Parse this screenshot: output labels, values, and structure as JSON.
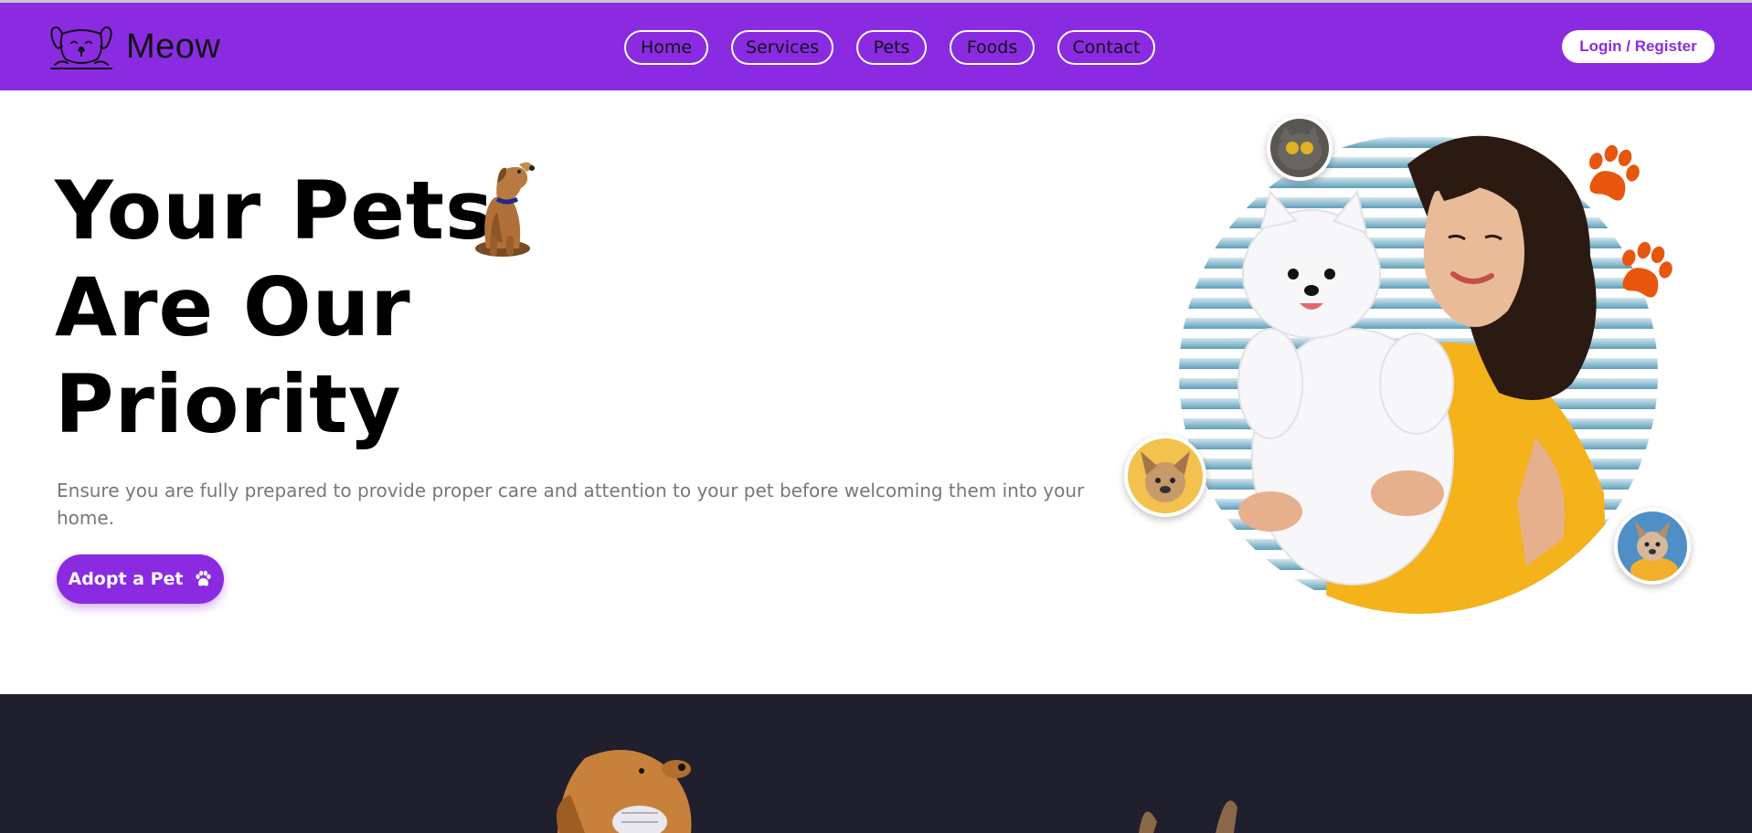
{
  "brand": {
    "name": "Meow",
    "logo_icon": "dog-face-icon"
  },
  "nav": {
    "items": [
      {
        "label": "Home"
      },
      {
        "label": "Services"
      },
      {
        "label": "Pets"
      },
      {
        "label": "Foods"
      },
      {
        "label": "Contact"
      }
    ],
    "login_label": "Login / Register"
  },
  "hero": {
    "title_lines": [
      "Your Pets",
      "Are Our",
      "Priority"
    ],
    "description": "Ensure you are fully prepared to provide proper care and attention to your pet before welcoming them into your home.",
    "cta_label": "Adopt a Pet",
    "cta_icon": "paw-icon"
  },
  "colors": {
    "accent": "#8a2be2",
    "dark_section": "#1f1f2e",
    "paw": "#e8560e",
    "text_muted": "#777777"
  }
}
